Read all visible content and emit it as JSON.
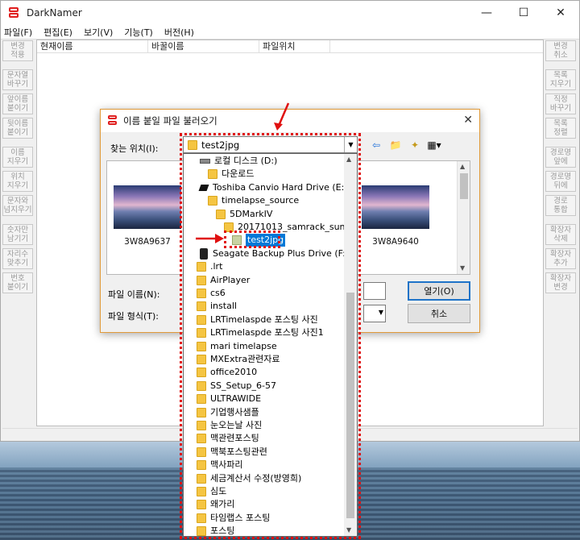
{
  "app": {
    "title": "DarkNamer",
    "menu": [
      "파일(F)",
      "편집(E)",
      "보기(V)",
      "기능(T)",
      "버전(H)"
    ],
    "window_buttons": {
      "min": "—",
      "max": "☐",
      "close": "✕"
    }
  },
  "left_tools": [
    [
      "변경",
      "적용"
    ],
    [
      "문자열",
      "바꾸기"
    ],
    [
      "앞이름",
      "붙이기"
    ],
    [
      "뒷이름",
      "붙이기"
    ],
    [
      "이름",
      "지우기"
    ],
    [
      "위치",
      "지우기"
    ],
    [
      "문자와",
      "넘지우기"
    ],
    [
      "숫자만",
      "남기기"
    ],
    [
      "자리수",
      "맞추기"
    ],
    [
      "번호",
      "붙이기"
    ]
  ],
  "right_tools": [
    [
      "변경",
      "취소"
    ],
    [
      "목록",
      "지우기"
    ],
    [
      "직정",
      "바꾸기"
    ],
    [
      "목록",
      "정렬"
    ],
    [
      "경로명",
      "앞에"
    ],
    [
      "경로명",
      "뒤에"
    ],
    [
      "경로",
      "통합"
    ],
    [
      "확장자",
      "삭제"
    ],
    [
      "확장자",
      "추가"
    ],
    [
      "확장자",
      "변경"
    ]
  ],
  "list_columns": [
    "현재이름",
    "바꿀이름",
    "파일위치"
  ],
  "dialog": {
    "title": "이름 붙일 파일 불러오기",
    "close": "✕",
    "lookin_label": "찾는 위치(I):",
    "lookin_value": "test2jpg",
    "thumbnails": [
      "3W8A9637",
      "3W8A9640"
    ],
    "filename_label": "파일 이름(N):",
    "filetype_label": "파일 형식(T):",
    "open_button": "열기(O)",
    "cancel_button": "취소"
  },
  "dropdown_items": [
    {
      "label": "로컬 디스크 (D:)",
      "icon": "hard-drive-icon",
      "indent": 0
    },
    {
      "label": "다운로드",
      "icon": "folder-icon",
      "indent": 1
    },
    {
      "label": "Toshiba Canvio Hard Drive (E:)",
      "icon": "usb-drive-icon",
      "indent": 0
    },
    {
      "label": "timelapse_source",
      "icon": "folder-icon",
      "indent": 1
    },
    {
      "label": "5DMarkIV",
      "icon": "folder-icon",
      "indent": 2
    },
    {
      "label": "20171013_samrack_sunset",
      "icon": "folder-icon",
      "indent": 3
    },
    {
      "label": "test2jpg",
      "icon": "folder-icon",
      "indent": 4,
      "selected": true
    },
    {
      "label": "Seagate Backup Plus Drive (F:)",
      "icon": "external-drive-icon",
      "indent": 0
    },
    {
      "label": ".lrt",
      "icon": "folder-icon",
      "indent": -1
    },
    {
      "label": "AirPlayer",
      "icon": "folder-icon",
      "indent": -1
    },
    {
      "label": "cs6",
      "icon": "folder-icon",
      "indent": -1
    },
    {
      "label": "install",
      "icon": "folder-icon",
      "indent": -1
    },
    {
      "label": "LRTimelaspde 포스팅 사진",
      "icon": "folder-icon",
      "indent": -1
    },
    {
      "label": "LRTimelaspde 포스팅 사진1",
      "icon": "folder-icon",
      "indent": -1
    },
    {
      "label": "mari timelapse",
      "icon": "folder-icon",
      "indent": -1
    },
    {
      "label": "MXExtra관련자료",
      "icon": "folder-icon",
      "indent": -1
    },
    {
      "label": "office2010",
      "icon": "folder-icon",
      "indent": -1
    },
    {
      "label": "SS_Setup_6-57",
      "icon": "folder-icon",
      "indent": -1
    },
    {
      "label": "ULTRAWIDE",
      "icon": "folder-icon",
      "indent": -1
    },
    {
      "label": "기업행사샘플",
      "icon": "folder-icon",
      "indent": -1
    },
    {
      "label": "눈오는날 사진",
      "icon": "folder-icon",
      "indent": -1
    },
    {
      "label": "맥관련포스팅",
      "icon": "folder-icon",
      "indent": -1
    },
    {
      "label": "맥북포스팅관련",
      "icon": "folder-icon",
      "indent": -1
    },
    {
      "label": "맥사파리",
      "icon": "folder-icon",
      "indent": -1
    },
    {
      "label": "세금계산서 수정(방영희)",
      "icon": "folder-icon",
      "indent": -1
    },
    {
      "label": "심도",
      "icon": "folder-icon",
      "indent": -1
    },
    {
      "label": "왜가리",
      "icon": "folder-icon",
      "indent": -1
    },
    {
      "label": "타임랩스 포스팅",
      "icon": "folder-icon",
      "indent": -1
    },
    {
      "label": "포스팅",
      "icon": "folder-icon",
      "indent": -1
    }
  ],
  "colors": {
    "annotation": "#e01010",
    "selection": "#0078d7",
    "folder": "#f5c542"
  }
}
